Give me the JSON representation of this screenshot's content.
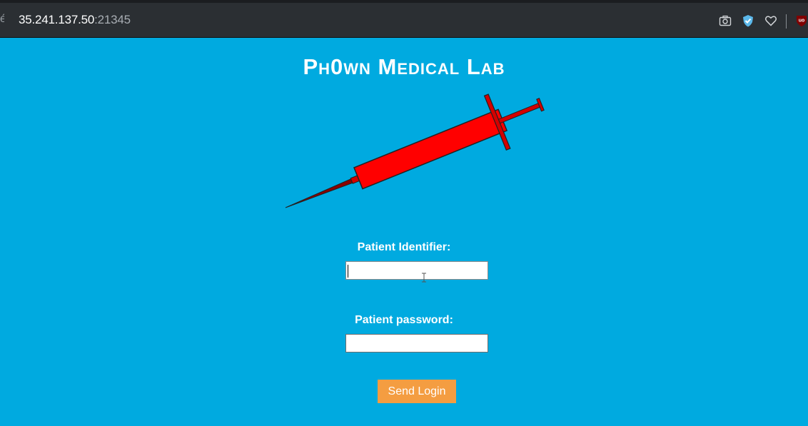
{
  "browser": {
    "url_host": "35.241.137.50",
    "url_port_sep": ":",
    "url_port": "21345",
    "icons": [
      "camera-icon",
      "shield-check-icon",
      "heart-icon",
      "ublock-icon"
    ]
  },
  "page": {
    "title": "Ph0wn Medical Lab",
    "image": "syringe-illustration",
    "form": {
      "identifier_label": "Patient Identifier:",
      "identifier_value": "",
      "password_label": "Patient password:",
      "password_value": "",
      "submit_label": "Send Login"
    }
  },
  "colors": {
    "background": "#00aae0",
    "button": "#f49d41",
    "syringe": "#ff0000",
    "toolbar": "#2b2f33"
  }
}
